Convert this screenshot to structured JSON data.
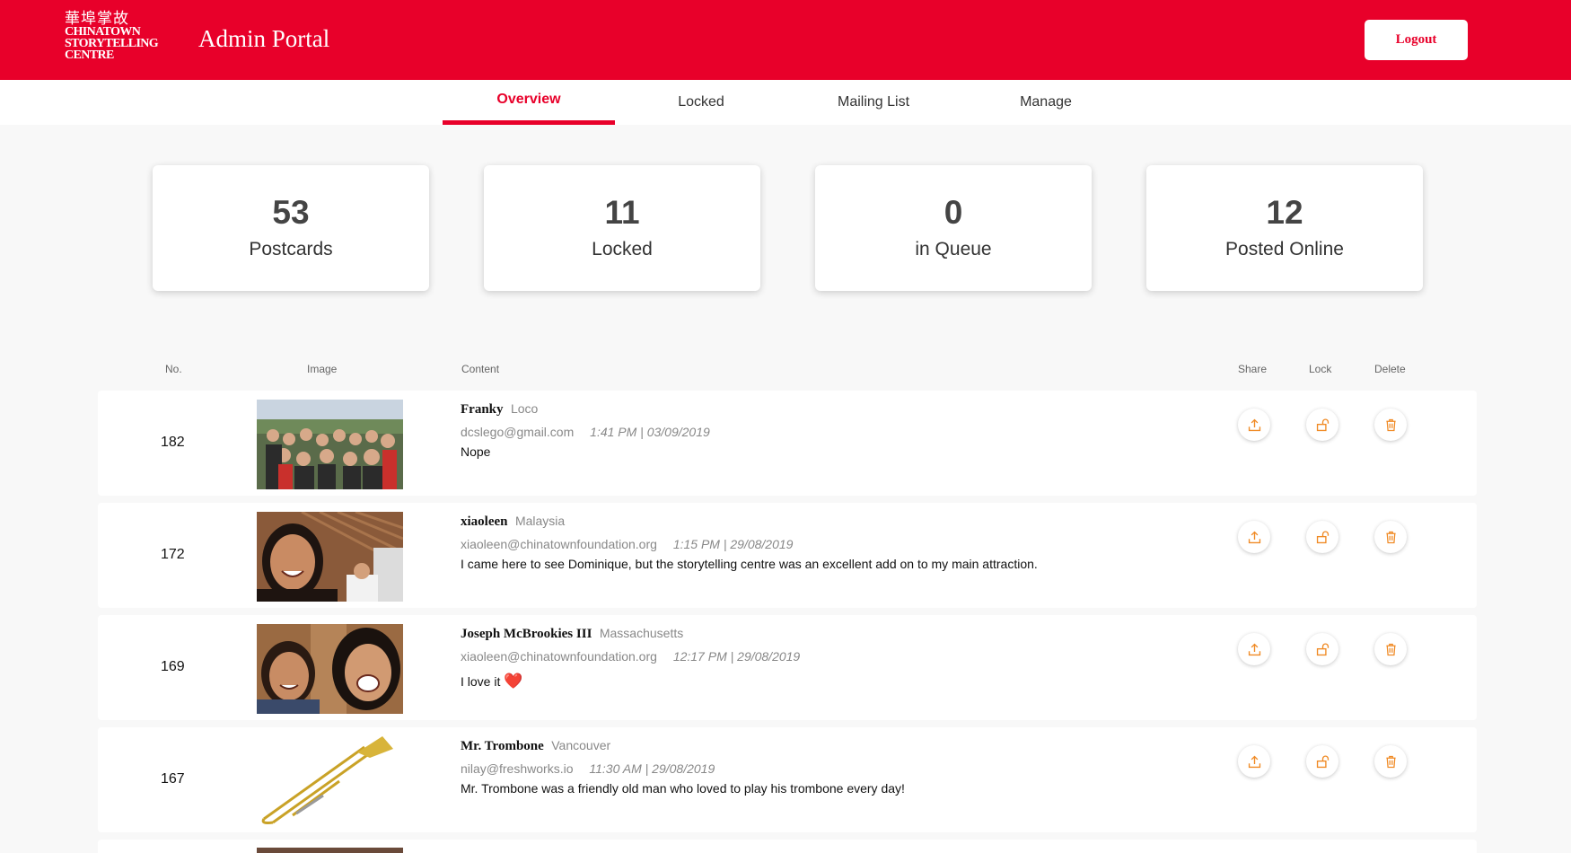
{
  "header": {
    "logo_cn": "華埠掌故",
    "logo_lines": [
      "CHINATOWN",
      "STORYTELLING",
      "CENTRE"
    ],
    "title": "Admin Portal",
    "logout_label": "Logout",
    "brand_color": "#e8002a"
  },
  "tabs": [
    {
      "label": "Overview",
      "active": true
    },
    {
      "label": "Locked",
      "active": false
    },
    {
      "label": "Mailing List",
      "active": false
    },
    {
      "label": "Manage",
      "active": false
    }
  ],
  "stats": [
    {
      "value": "53",
      "label": "Postcards"
    },
    {
      "value": "11",
      "label": "Locked"
    },
    {
      "value": "0",
      "label": "in Queue"
    },
    {
      "value": "12",
      "label": "Posted Online"
    }
  ],
  "table": {
    "columns": {
      "no": "No.",
      "image": "Image",
      "content": "Content",
      "share": "Share",
      "lock": "Lock",
      "delete": "Delete"
    },
    "rows": [
      {
        "no": "182",
        "author": "Franky",
        "location": "Loco",
        "email": "dcslego@gmail.com",
        "timestamp": "1:41 PM | 03/09/2019",
        "message": "Nope",
        "image": "group-photo"
      },
      {
        "no": "172",
        "author": "xiaoleen",
        "location": "Malaysia",
        "email": "xiaoleen@chinatownfoundation.org",
        "timestamp": "1:15 PM | 29/08/2019",
        "message": "I came here to see Dominique, but the storytelling centre was an excellent add on to my main attraction.",
        "image": "selfie-photo"
      },
      {
        "no": "169",
        "author": "Joseph McBrookies III",
        "location": "Massachusetts",
        "email": "xiaoleen@chinatownfoundation.org",
        "timestamp": "12:17 PM | 29/08/2019",
        "message": "I love it",
        "emoji": "❤️",
        "image": "two-people-photo"
      },
      {
        "no": "167",
        "author": "Mr. Trombone",
        "location": "Vancouver",
        "email": "nilay@freshworks.io",
        "timestamp": "11:30 AM | 29/08/2019",
        "message": "Mr. Trombone was a friendly old man who loved to play his trombone every day!",
        "image": "trombone-photo"
      }
    ],
    "icon_color": "#f08a24"
  }
}
